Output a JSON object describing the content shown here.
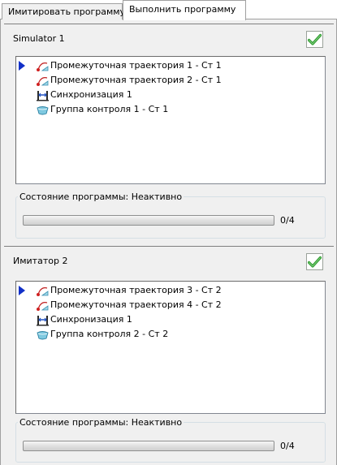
{
  "tabs": [
    {
      "label": "Имитировать программу",
      "active": false
    },
    {
      "label": "Выполнить программу",
      "active": true
    }
  ],
  "panels": [
    {
      "title": "Simulator 1",
      "checked": true,
      "items": [
        {
          "label": "Промежуточная траектория 1 - Ст 1",
          "icon": "trajectory-icon",
          "current": true
        },
        {
          "label": "Промежуточная траектория 2 - Ст 1",
          "icon": "trajectory-icon",
          "current": false
        },
        {
          "label": "Синхронизация 1",
          "icon": "sync-icon",
          "current": false
        },
        {
          "label": "Группа контроля 1 - Ст 1",
          "icon": "control-group-icon",
          "current": false
        }
      ],
      "status": "Состояние программы: Неактивно",
      "progress": {
        "value": 0,
        "total": 4,
        "text": "0/4"
      }
    },
    {
      "title": "Имитатор 2",
      "checked": true,
      "items": [
        {
          "label": "Промежуточная траектория 3 - Ст 2",
          "icon": "trajectory-icon",
          "current": true
        },
        {
          "label": "Промежуточная траектория 4 - Ст 2",
          "icon": "trajectory-icon",
          "current": false
        },
        {
          "label": "Синхронизация 1",
          "icon": "sync-icon",
          "current": false
        },
        {
          "label": "Группа контроля 2 - Ст 2",
          "icon": "control-group-icon",
          "current": false
        }
      ],
      "status": "Состояние программы: Неактивно",
      "progress": {
        "value": 0,
        "total": 4,
        "text": "0/4"
      }
    }
  ],
  "colors": {
    "marker": "#1230c8",
    "check": "#2e9a2e",
    "panel_bg": "#f0f0f0"
  }
}
